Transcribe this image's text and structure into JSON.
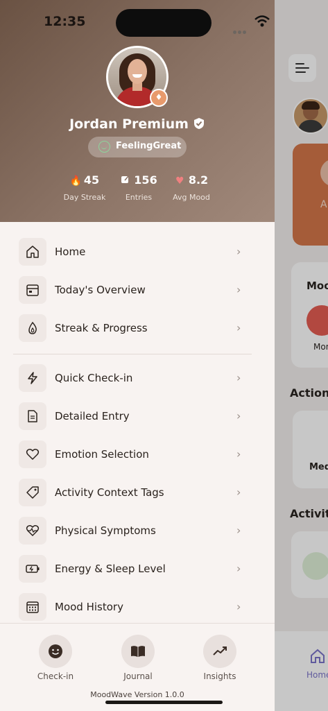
{
  "status_bar": {
    "time": "12:35"
  },
  "profile": {
    "name": "Jordan Premium",
    "status": "FeelingGreat",
    "stats": [
      {
        "value": "45",
        "label": "Day Streak",
        "icon": "flame-icon"
      },
      {
        "value": "156",
        "label": "Entries",
        "icon": "edit-icon"
      },
      {
        "value": "8.2",
        "label": "Avg Mood",
        "icon": "heart-icon"
      }
    ]
  },
  "menu": {
    "items": [
      {
        "label": "Home",
        "icon": "home-icon"
      },
      {
        "label": "Today's Overview",
        "icon": "calendar-icon"
      },
      {
        "label": "Streak & Progress",
        "icon": "flame-icon"
      },
      {
        "label": "Quick Check-in",
        "icon": "lightning-icon"
      },
      {
        "label": "Detailed Entry",
        "icon": "document-icon"
      },
      {
        "label": "Emotion Selection",
        "icon": "heart-icon"
      },
      {
        "label": "Activity Context Tags",
        "icon": "tag-icon"
      },
      {
        "label": "Physical Symptoms",
        "icon": "heartbeat-icon"
      },
      {
        "label": "Energy & Sleep Level",
        "icon": "battery-icon"
      },
      {
        "label": "Mood History",
        "icon": "calendar-grid-icon"
      }
    ]
  },
  "bottom_actions": [
    {
      "label": "Check-in",
      "icon": "smiley-icon"
    },
    {
      "label": "Journal",
      "icon": "book-icon"
    },
    {
      "label": "Insights",
      "icon": "trend-icon"
    }
  ],
  "version": "MoodWave Version 1.0.0",
  "background_app": {
    "tile_label": "A",
    "mood_label": "Moo",
    "mood_item": "Mon",
    "actions_label": "Actions",
    "action_item": "Med",
    "activity_label": "Activity",
    "nav_home": "Home"
  },
  "colors": {
    "accent": "#d4774a",
    "header": "#7a6152",
    "drawer_bg": "#f8f3f1",
    "nav_active": "#7b74c9"
  }
}
